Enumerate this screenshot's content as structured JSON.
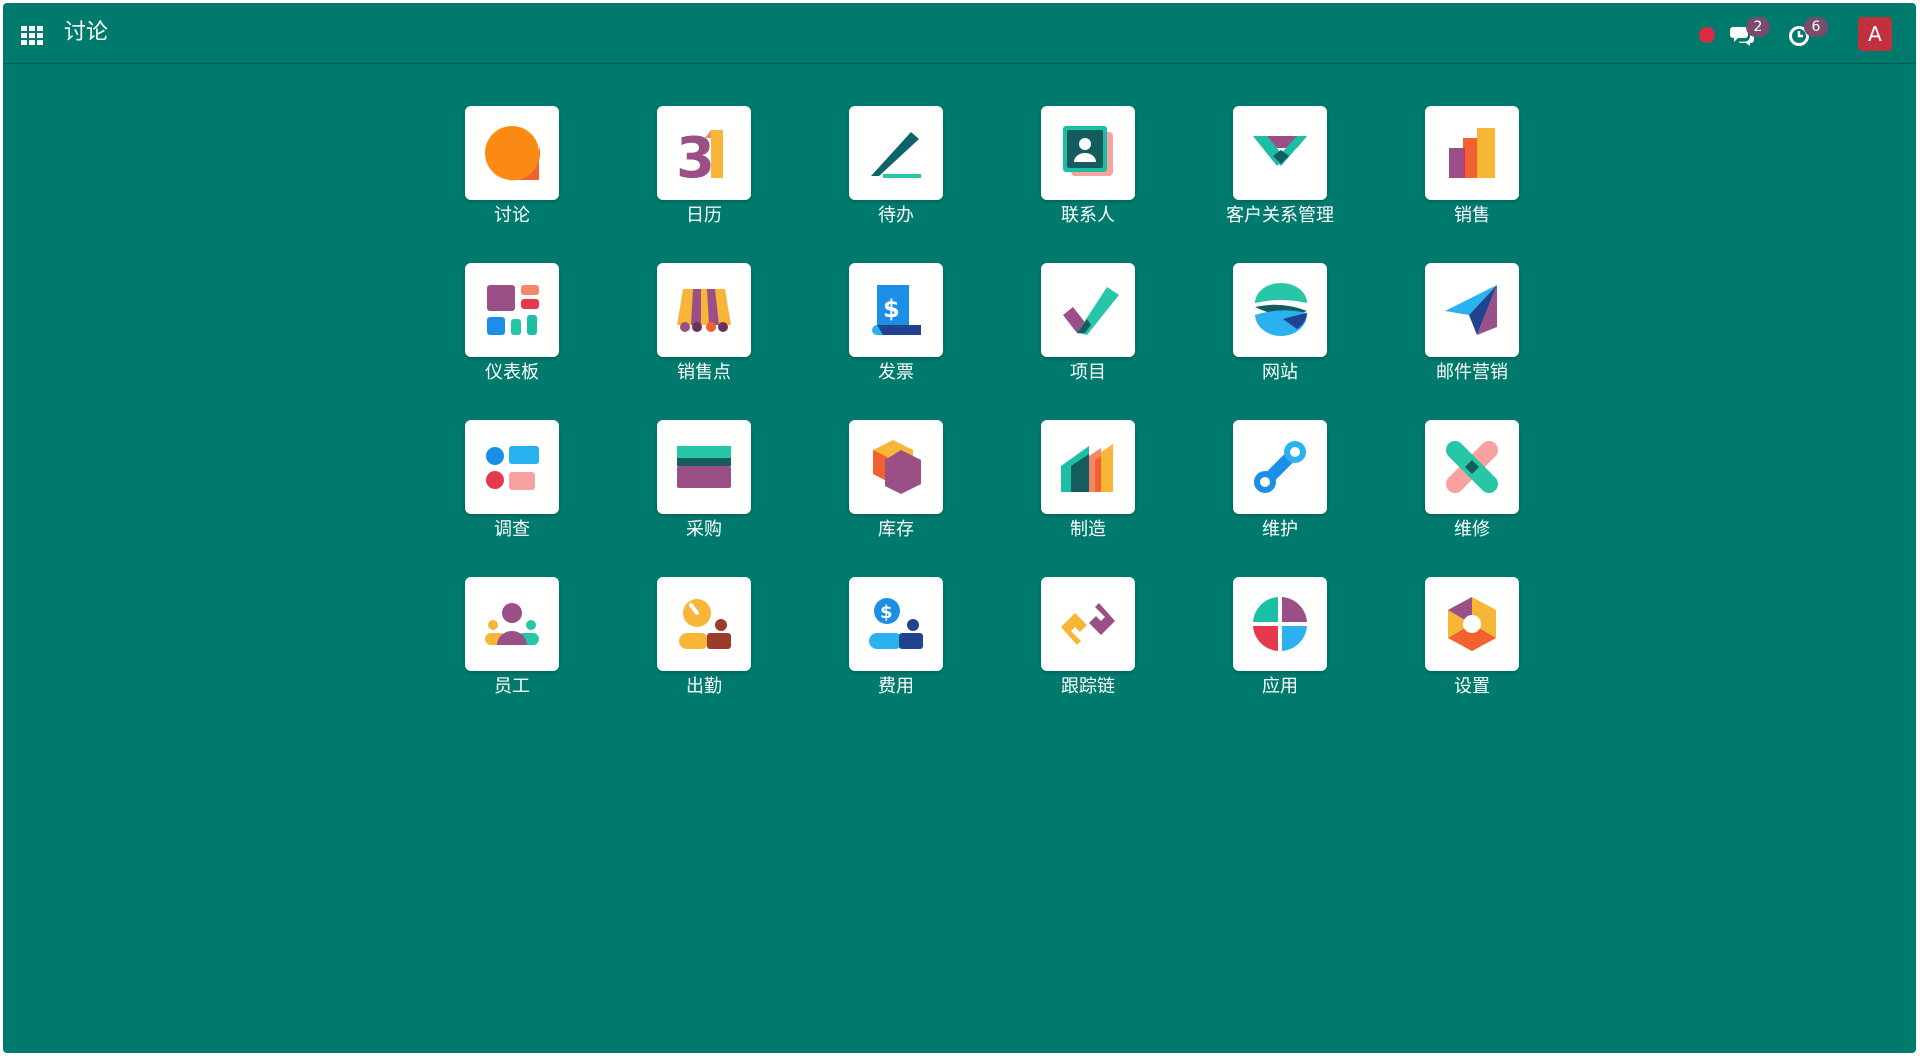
{
  "navbar": {
    "brand": "讨论",
    "messages_count": "2",
    "activities_count": "6",
    "avatar_initial": "A",
    "status_color": "#dc2a43"
  },
  "apps": [
    {
      "label": "讨论",
      "icon": "discuss-icon"
    },
    {
      "label": "日历",
      "icon": "calendar-icon"
    },
    {
      "label": "待办",
      "icon": "todo-icon"
    },
    {
      "label": "联系人",
      "icon": "contacts-icon"
    },
    {
      "label": "客户关系管理",
      "icon": "crm-icon"
    },
    {
      "label": "销售",
      "icon": "sales-icon"
    },
    {
      "label": "仪表板",
      "icon": "dashboard-icon"
    },
    {
      "label": "销售点",
      "icon": "point-of-sale-icon"
    },
    {
      "label": "发票",
      "icon": "invoicing-icon"
    },
    {
      "label": "项目",
      "icon": "project-icon"
    },
    {
      "label": "网站",
      "icon": "website-icon"
    },
    {
      "label": "邮件营销",
      "icon": "email-marketing-icon"
    },
    {
      "label": "调查",
      "icon": "surveys-icon"
    },
    {
      "label": "采购",
      "icon": "purchase-icon"
    },
    {
      "label": "库存",
      "icon": "inventory-icon"
    },
    {
      "label": "制造",
      "icon": "manufacturing-icon"
    },
    {
      "label": "维护",
      "icon": "maintenance-icon"
    },
    {
      "label": "维修",
      "icon": "repairs-icon"
    },
    {
      "label": "员工",
      "icon": "employees-icon"
    },
    {
      "label": "出勤",
      "icon": "attendances-icon"
    },
    {
      "label": "费用",
      "icon": "expenses-icon"
    },
    {
      "label": "跟踪链",
      "icon": "link-tracker-icon"
    },
    {
      "label": "应用",
      "icon": "apps-icon"
    },
    {
      "label": "设置",
      "icon": "settings-icon"
    }
  ],
  "colors": {
    "background": "#017a6e",
    "avatar": "#c0313d",
    "badge": "#7a4b6c"
  }
}
